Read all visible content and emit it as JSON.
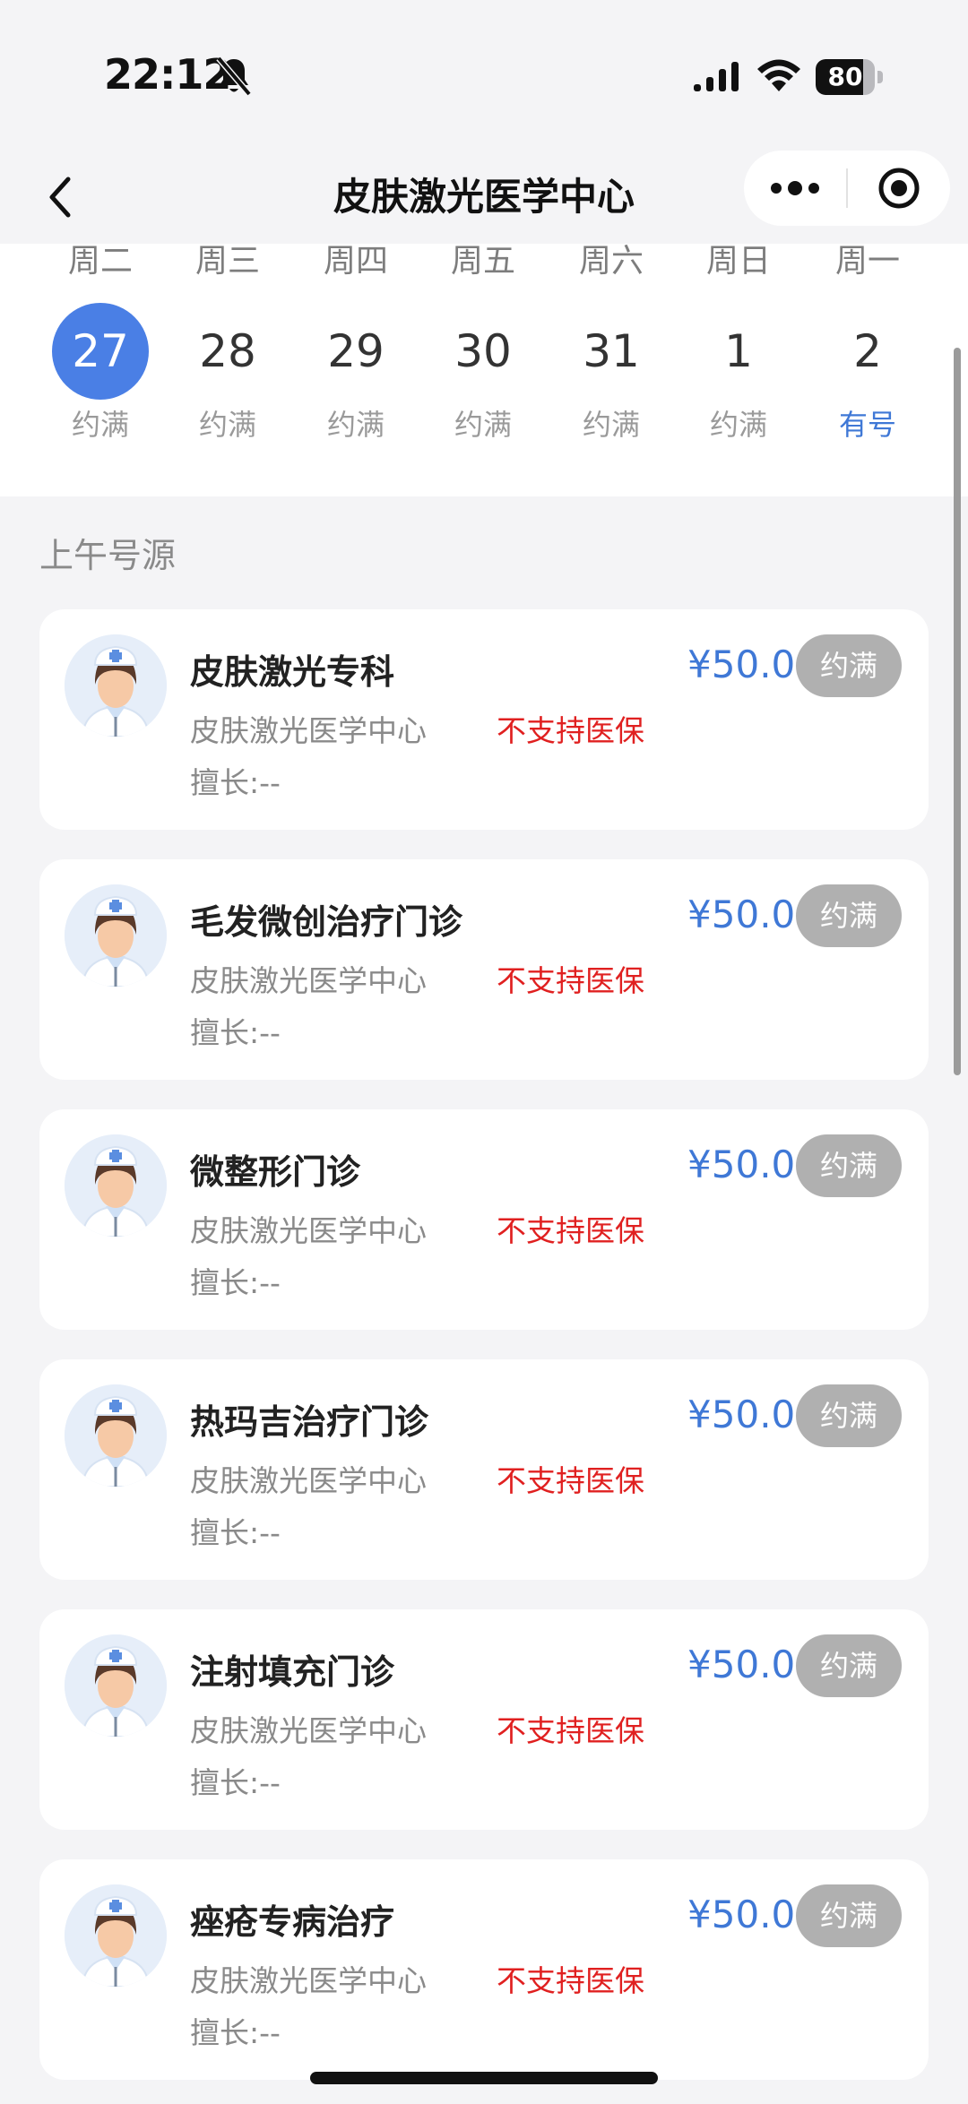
{
  "status_bar": {
    "time": "22:12",
    "battery": "80",
    "battery_level": 0.8
  },
  "nav": {
    "title": "皮肤激光医学中心"
  },
  "dates": [
    {
      "weekday": "周二",
      "day": "27",
      "status": "约满",
      "selected": true,
      "available": false
    },
    {
      "weekday": "周三",
      "day": "28",
      "status": "约满",
      "selected": false,
      "available": false
    },
    {
      "weekday": "周四",
      "day": "29",
      "status": "约满",
      "selected": false,
      "available": false
    },
    {
      "weekday": "周五",
      "day": "30",
      "status": "约满",
      "selected": false,
      "available": false
    },
    {
      "weekday": "周六",
      "day": "31",
      "status": "约满",
      "selected": false,
      "available": false
    },
    {
      "weekday": "周日",
      "day": "1",
      "status": "约满",
      "selected": false,
      "available": false
    },
    {
      "weekday": "周一",
      "day": "2",
      "status": "有号",
      "selected": false,
      "available": true
    }
  ],
  "section_title": "上午号源",
  "clinics": [
    {
      "name": "皮肤激光专科",
      "dept": "皮肤激光医学中心",
      "insurance": "不支持医保",
      "skill": "擅长:--",
      "price": "¥50.00",
      "status": "约满"
    },
    {
      "name": "毛发微创治疗门诊",
      "dept": "皮肤激光医学中心",
      "insurance": "不支持医保",
      "skill": "擅长:--",
      "price": "¥50.00",
      "status": "约满"
    },
    {
      "name": "微整形门诊",
      "dept": "皮肤激光医学中心",
      "insurance": "不支持医保",
      "skill": "擅长:--",
      "price": "¥50.00",
      "status": "约满"
    },
    {
      "name": "热玛吉治疗门诊",
      "dept": "皮肤激光医学中心",
      "insurance": "不支持医保",
      "skill": "擅长:--",
      "price": "¥50.00",
      "status": "约满"
    },
    {
      "name": "注射填充门诊",
      "dept": "皮肤激光医学中心",
      "insurance": "不支持医保",
      "skill": "擅长:--",
      "price": "¥50.00",
      "status": "约满"
    },
    {
      "name": "痤疮专病治疗",
      "dept": "皮肤激光医学中心",
      "insurance": "不支持医保",
      "skill": "擅长:--",
      "price": "¥50.00",
      "status": "约满"
    }
  ],
  "colors": {
    "accent": "#4a7fe5",
    "price": "#3f78d6",
    "warning": "#e02020",
    "full_badge": "#b0b0b0"
  },
  "icons": {
    "back": "chevron-left-icon",
    "more": "more-dots-icon",
    "close": "target-circle-icon",
    "avatar": "nurse-avatar-icon"
  }
}
